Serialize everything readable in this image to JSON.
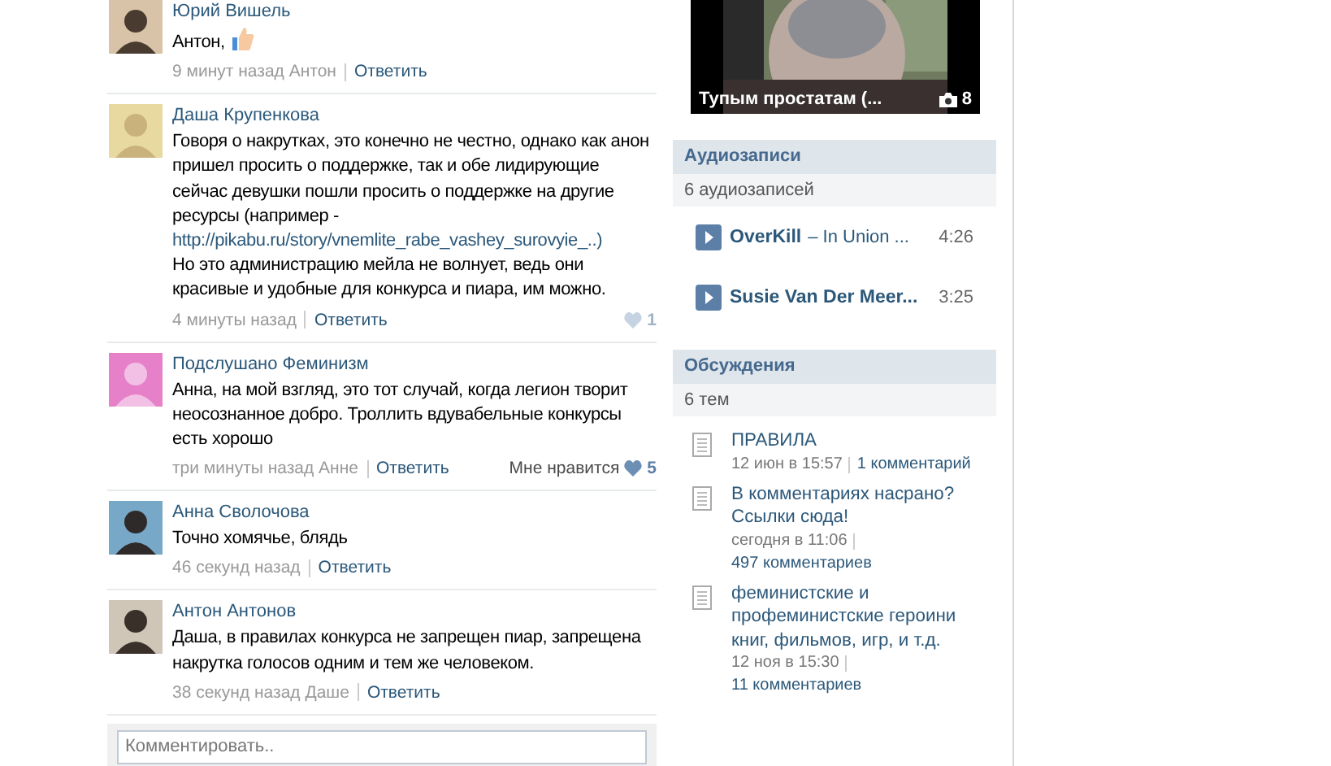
{
  "comments": [
    {
      "author": "Юрий Вишель",
      "text": "Антон,",
      "emoji": true,
      "time": "9 минут назад Антон",
      "reply": "Ответить"
    },
    {
      "author": "Даша Крупенкова",
      "text": "Говоря о накрутках, это конечно не честно, однако как анон пришел просить о поддержке, так и обе лидирующие сейчас девушки пошли просить о поддержке на другие ресурсы (например -",
      "link": "http://pikabu.ru/story/vnemlite_rabe_vashey_surovyie_..)",
      "text_after": "Но это администрацию мейла не волнует, ведь они красивые и удобные для конкурса и пиара, им можно.",
      "time": "4 минуты назад",
      "reply": "Ответить",
      "likes": {
        "count": "1",
        "active": false
      }
    },
    {
      "author": "Подслушано Феминизм",
      "text": "Анна, на мой взгляд, это тот случай, когда легион творит неосознанное добро. Троллить вдувабельные конкурсы есть хорошо",
      "time": "три минуты назад Анне",
      "reply": "Ответить",
      "likes": {
        "label": "Мне нравится",
        "count": "5",
        "active": true
      }
    },
    {
      "author": "Анна Сволочова",
      "text": "Точно хомячье, блядь",
      "time": "46 секунд назад",
      "reply": "Ответить"
    },
    {
      "author": "Антон Антонов",
      "text": "Даша, в правилах конкурса не запрещен пиар, запрещена накрутка голосов одним и тем же человеком.",
      "time": "38 секунд назад Даше",
      "reply": "Ответить"
    }
  ],
  "comment_field": {
    "placeholder": "Комментировать.."
  },
  "album": {
    "caption": "Тупым простатам (...",
    "count": "8"
  },
  "audio": {
    "title": "Аудиозаписи",
    "count": "6 аудиозаписей",
    "tracks": [
      {
        "artist": "OverKill",
        "title": "– In Union ...",
        "duration": "4:26"
      },
      {
        "artist": "Susie Van Der Meer...",
        "duration": "3:25"
      }
    ]
  },
  "discussions": {
    "title": "Обсуждения",
    "count": "6 тем",
    "topics": [
      {
        "title": "ПРАВИЛА",
        "date": "12 июн в 15:57",
        "comments": "1 комментарий"
      },
      {
        "title": "В комментариях насрано? Ссылки сюда!",
        "date": "сегодня в 11:06",
        "comments": "497 комментариев"
      },
      {
        "title": "феминистские и профеминистские героини книг, фильмов, игр, и т.д.",
        "date": "12 ноя в 15:30",
        "comments": "11 комментариев"
      }
    ]
  }
}
